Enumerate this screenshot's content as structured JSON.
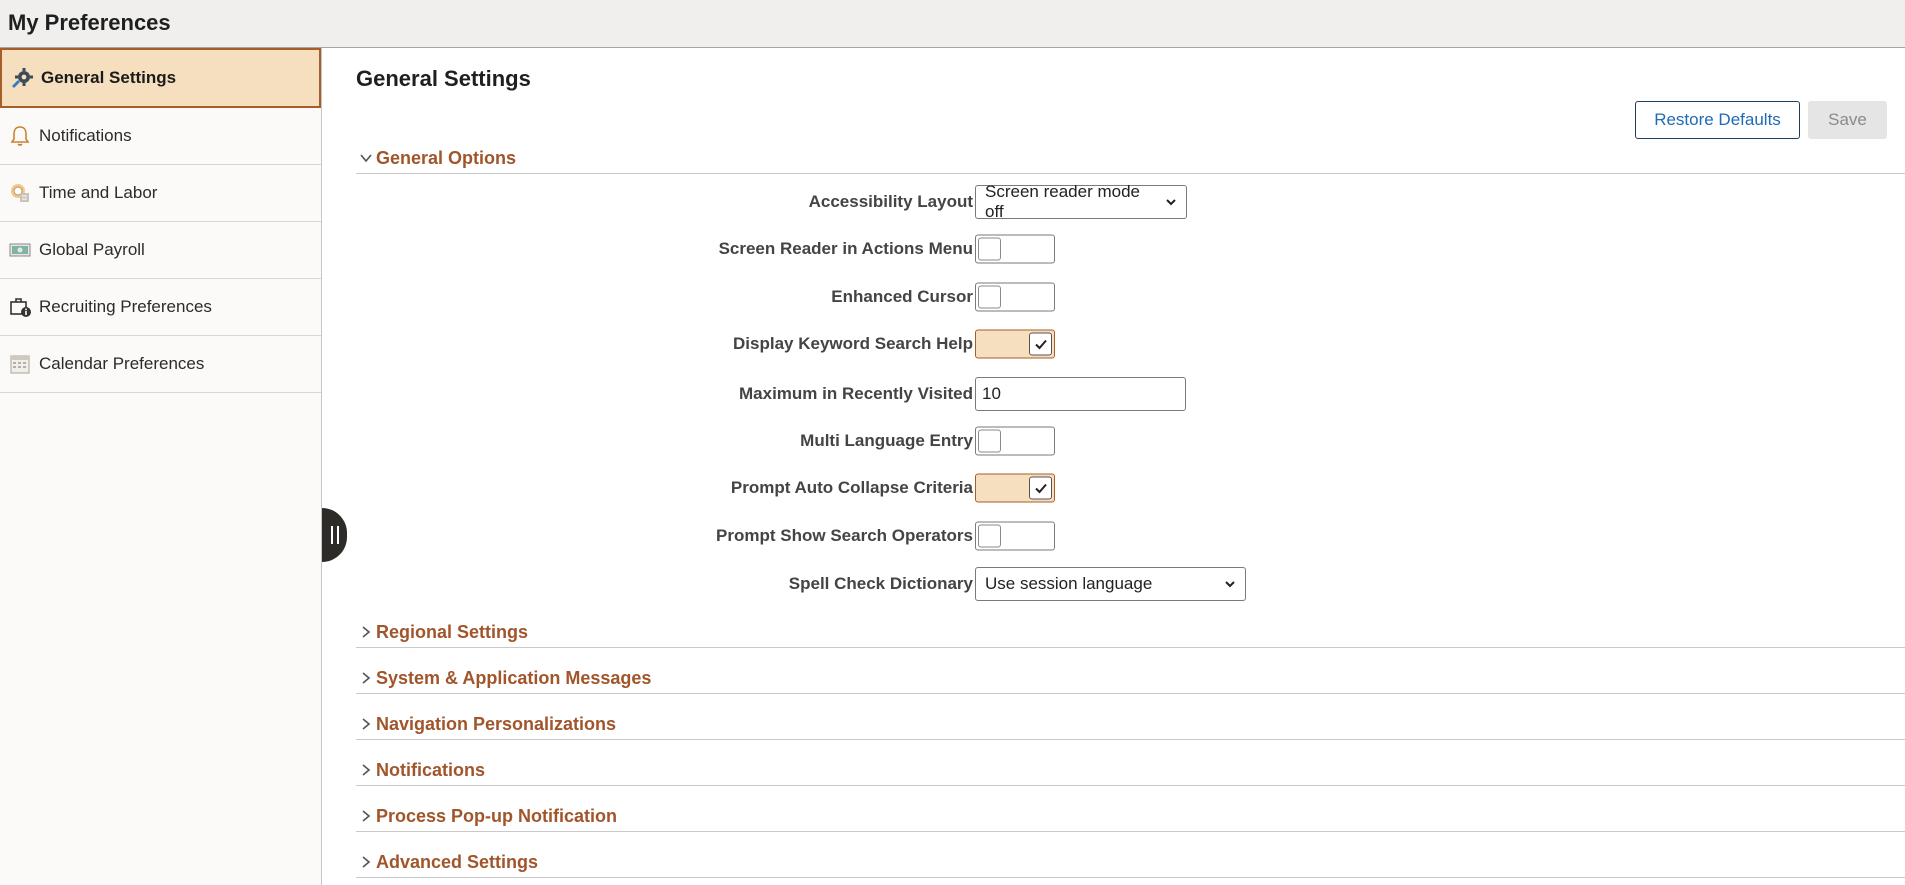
{
  "app": {
    "title": "My Preferences"
  },
  "sidebar": {
    "items": [
      {
        "label": "General Settings",
        "icon": "settings-gears-icon",
        "active": true
      },
      {
        "label": "Notifications",
        "icon": "bell-icon"
      },
      {
        "label": "Time and Labor",
        "icon": "time-labor-icon"
      },
      {
        "label": "Global Payroll",
        "icon": "payroll-icon"
      },
      {
        "label": "Recruiting Preferences",
        "icon": "briefcase-info-icon"
      },
      {
        "label": "Calendar Preferences",
        "icon": "calendar-icon"
      }
    ]
  },
  "main": {
    "title": "General Settings",
    "buttons": {
      "restore_defaults": "Restore Defaults",
      "save": "Save"
    },
    "sections": [
      {
        "label": "General Options",
        "expanded": true
      },
      {
        "label": "Regional Settings",
        "expanded": false
      },
      {
        "label": "System & Application Messages",
        "expanded": false
      },
      {
        "label": "Navigation Personalizations",
        "expanded": false
      },
      {
        "label": "Notifications",
        "expanded": false
      },
      {
        "label": "Process Pop-up Notification",
        "expanded": false
      },
      {
        "label": "Advanced Settings",
        "expanded": false
      }
    ],
    "general_options": {
      "accessibility_layout": {
        "label": "Accessibility Layout",
        "value": "Screen reader mode off"
      },
      "screen_reader_actions_menu": {
        "label": "Screen Reader in Actions Menu",
        "checked": false
      },
      "enhanced_cursor": {
        "label": "Enhanced Cursor",
        "checked": false
      },
      "display_keyword_search_help": {
        "label": "Display Keyword Search Help",
        "checked": true
      },
      "max_recently_visited": {
        "label": "Maximum in Recently Visited",
        "value": "10"
      },
      "multi_language_entry": {
        "label": "Multi Language Entry",
        "checked": false
      },
      "prompt_auto_collapse": {
        "label": "Prompt Auto Collapse Criteria",
        "checked": true
      },
      "prompt_show_search_operators": {
        "label": "Prompt Show Search Operators",
        "checked": false
      },
      "spell_check_dictionary": {
        "label": "Spell Check Dictionary",
        "value": "Use session language"
      }
    }
  },
  "colors": {
    "accent": "#a0552a",
    "active_bg": "#f6dfbf",
    "link_blue": "#1f6bb3"
  }
}
